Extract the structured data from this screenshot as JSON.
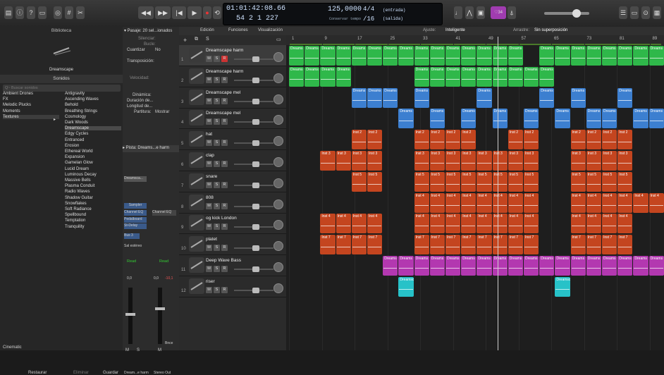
{
  "colors": {
    "green": "#2fb84a",
    "blue": "#3c7fd0",
    "red": "#c4451f",
    "purple": "#b338b0",
    "cyan": "#27c2c8"
  },
  "transport": {
    "position": "01:01:42:08.66",
    "bars": "54  2  1  227",
    "tempo": "125,0000",
    "signature": "4/4",
    "division": "/16",
    "in_label": "(entrada)",
    "out_label": "(salida)",
    "keep_tempo": "Conservar tempo",
    "cpu": "♡34"
  },
  "library": {
    "header": "Biblioteca",
    "patch": "Dreamscape",
    "sounds_tab": "Sonidos",
    "search": "Q~ Buscar sonidos",
    "categories": [
      "Ambient Drones",
      "FX",
      "Melodic Plucks",
      "Moments",
      "Textures"
    ],
    "sounds": [
      "Antigravity",
      "Ascending Waves",
      "Behold",
      "Breathing Strings",
      "Cosmology",
      "Dark Woods",
      "Dreamscape",
      "Edgy Cycles",
      "Entranced",
      "Erosion",
      "Ethereal World",
      "Expansion",
      "Gamelan Glow",
      "Lucid Dream",
      "Luminous Decay",
      "Massive Bells",
      "Plasma Conduit",
      "Radio Waves",
      "Shadow Guitar",
      "Snowflakes",
      "Soft Radiance",
      "Spellbound",
      "Temptation",
      "Tranquility"
    ],
    "footer": "Cinematic",
    "restore": "Restaurar",
    "delete": "Eliminar",
    "save": "Guardar"
  },
  "inspector": {
    "region_header": "▾ Pasaje: 20 sel...ionados",
    "track_header": "▸ Pista: Dreams...e harm",
    "row1": "Silenciar:",
    "row2": "Bucle:",
    "row3": "Cuantizar",
    "row3v": "No",
    "row4": "Transposición:",
    "row5": "Velocidad:",
    "row6": "Dinámica:",
    "row7": "Duración de...",
    "row8": "Longitud de...",
    "row9": "Partitura:",
    "row9v": "Mostrar",
    "strip1": "Dreamsca...",
    "plugin": "Sampler",
    "eq1": "Channel EQ",
    "eq2": "Channel EQ",
    "fx1": "Pedalboard",
    "fx2": "St-Delay",
    "bus": "Bus 3",
    "stereo": "Sal estéreo",
    "read1": "Read",
    "read2": "Read",
    "val1": "0,0",
    "val2": "0,0",
    "val3": "-10,1",
    "m": "M",
    "s": "S",
    "bnce": "Bnce",
    "name_left": "Dream...e harm",
    "name_right": "Stereo Out"
  },
  "tracks_toolbar": {
    "edit": "Edición",
    "functions": "Funciones",
    "view": "Visualización",
    "snap": "Ajuste:",
    "snap_v": "Inteligente",
    "drag": "Arrastre:",
    "drag_v": "Sin superposición"
  },
  "ruler": [
    "1",
    "9",
    "17",
    "25",
    "33",
    "41",
    "49",
    "57",
    "65",
    "73",
    "81",
    "89"
  ],
  "tracks": [
    {
      "n": "1",
      "name": "Dreamscape harm",
      "color": "green"
    },
    {
      "n": "2",
      "name": "Dreamscape harm",
      "color": "green"
    },
    {
      "n": "3",
      "name": "Dreamscape mel",
      "color": "blue"
    },
    {
      "n": "4",
      "name": "Dreamscape mel",
      "color": "blue"
    },
    {
      "n": "5",
      "name": "hat",
      "color": "red"
    },
    {
      "n": "6",
      "name": "clap",
      "color": "red"
    },
    {
      "n": "7",
      "name": "snare",
      "color": "red"
    },
    {
      "n": "8",
      "name": "808",
      "color": "red"
    },
    {
      "n": "9",
      "name": "og kick London",
      "color": "red"
    },
    {
      "n": "10",
      "name": "platet",
      "color": "red"
    },
    {
      "n": "11",
      "name": "Deep Wave Bass",
      "color": "purple"
    },
    {
      "n": "12",
      "name": "riser",
      "color": "cyan"
    }
  ],
  "region_labels": {
    "green": "Dreams",
    "blue": "Dreams",
    "purple": "Dreams",
    "cyan": "Dreamsca",
    "hat": "Inst 2",
    "clap": "Inst 3",
    "snare": "Inst 5",
    "808": "Inst 4",
    "kick": "Inst 4",
    "platet": "Inst 7"
  }
}
